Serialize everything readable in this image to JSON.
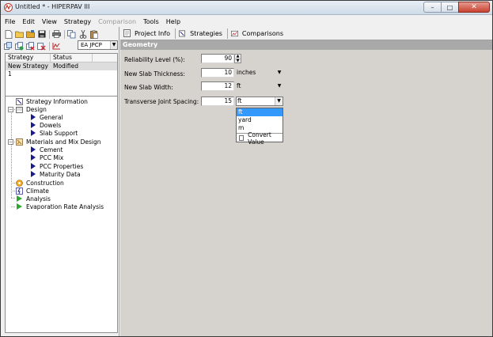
{
  "window": {
    "title": "Untitled * - HIPERPAV III",
    "controls": {
      "minimize": "–",
      "maximize": "□",
      "close": "✕"
    }
  },
  "menu": [
    {
      "label": "File",
      "enabled": true
    },
    {
      "label": "Edit",
      "enabled": true
    },
    {
      "label": "View",
      "enabled": true
    },
    {
      "label": "Strategy",
      "enabled": true
    },
    {
      "label": "Comparison",
      "enabled": false
    },
    {
      "label": "Tools",
      "enabled": true
    },
    {
      "label": "Help",
      "enabled": true
    }
  ],
  "left_toolbar": {
    "icons_row1": [
      "new-file-icon",
      "open-folder-icon",
      "open-project-icon",
      "save-icon",
      "print-icon",
      "copy-icon",
      "cut-icon",
      "paste-icon"
    ],
    "icons_row2": [
      "strategy-new-icon",
      "strategy-copy-icon",
      "strategy-delete-icon",
      "strategy-cancel-icon",
      "strategy-run-icon"
    ],
    "strategy_type": "EA JPCP"
  },
  "strategy_list": {
    "headers": [
      "Strategy",
      "Status"
    ],
    "rows": [
      {
        "strategy": "New Strategy 1",
        "status": "Modified"
      }
    ]
  },
  "tree": {
    "items": {
      "strategy_information": "Strategy Information",
      "design": "Design",
      "general": "General",
      "dowels": "Dowels",
      "slab_support": "Slab Support",
      "materials": "Materials and Mix Design",
      "cement": "Cement",
      "pcc_mix": "PCC Mix",
      "pcc_properties": "PCC Properties",
      "maturity_data": "Maturity Data",
      "construction": "Construction",
      "climate": "Climate",
      "analysis": "Analysis",
      "evaporation": "Evaporation Rate Analysis"
    }
  },
  "tabs": [
    {
      "label": "Project Info",
      "icon": "document-icon"
    },
    {
      "label": "Strategies",
      "icon": "strategies-icon"
    },
    {
      "label": "Comparisons",
      "icon": "chart-icon"
    }
  ],
  "geometry": {
    "header": "Geometry",
    "fields": {
      "reliability": {
        "label": "Reliability Level (%):",
        "value": "90"
      },
      "thickness": {
        "label": "New Slab Thickness:",
        "value": "10",
        "unit": "inches"
      },
      "width": {
        "label": "New Slab Width:",
        "value": "12",
        "unit": "ft"
      },
      "joint_spacing": {
        "label": "Transverse Joint Spacing:",
        "value": "15",
        "unit": "ft"
      }
    },
    "unit_dropdown": {
      "options": [
        "ft",
        "yard",
        "m"
      ],
      "selected": "ft",
      "convert_label": "Convert Value",
      "convert_checked": false
    }
  },
  "colors": {
    "selection": "#3399ff",
    "section_header": "#a9a9a9",
    "content_bg": "#d6d3ce",
    "tree_arrow": "#1a1a8c",
    "analysis_arrow": "#2aa830"
  }
}
